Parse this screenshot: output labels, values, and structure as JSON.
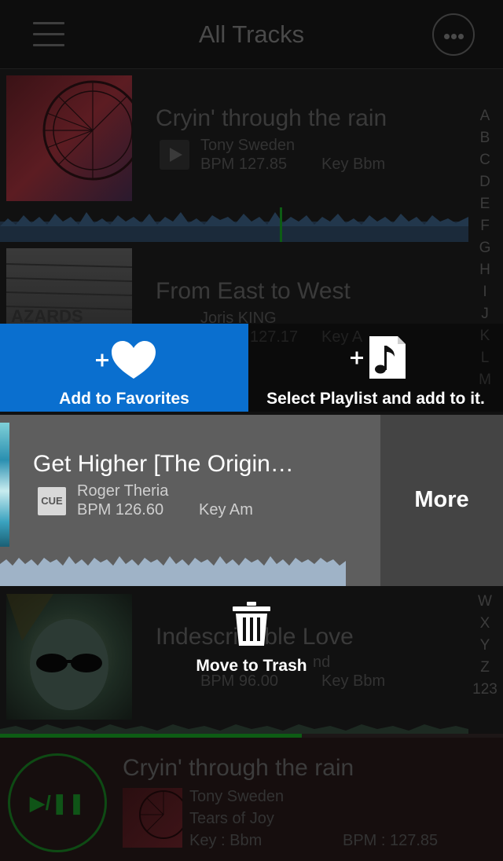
{
  "header": {
    "title": "All Tracks"
  },
  "tracks": [
    {
      "title": "Cryin' through the rain",
      "artist": "Tony Sweden",
      "bpm": "BPM 127.85",
      "key": "Key Bbm"
    },
    {
      "title": "From East to West",
      "artist": "Joris KING",
      "bpm": "127.17",
      "key": "Key A"
    },
    {
      "title": "Indescribable Love",
      "artist": "nd",
      "bpm": "BPM 96.00",
      "key": "Key Bbm"
    }
  ],
  "active_track": {
    "title": "Get Higher [The Origin…",
    "cue_label": "CUE",
    "artist": "Roger Theria",
    "bpm": "BPM 126.60",
    "key": "Key Am"
  },
  "actions": {
    "favorites_label": "Add to Favorites",
    "playlist_label": "Select Playlist and add to it.",
    "more_label": "More",
    "trash_label": "Move to Trash",
    "plus_symbol": "+"
  },
  "alphabet_top": [
    "A",
    "B",
    "C",
    "D",
    "E",
    "F",
    "G",
    "H",
    "I",
    "J",
    "K",
    "L",
    "M"
  ],
  "alphabet_bottom": [
    "W",
    "X",
    "Y",
    "Z",
    "123"
  ],
  "now_playing": {
    "title": "Cryin' through the rain",
    "artist": "Tony Sweden",
    "album": "Tears of Joy",
    "key": "Key : Bbm",
    "bpm": "BPM : 127.85",
    "play_pause_symbol": "▶/❚❚",
    "progress": 0.6
  },
  "colors": {
    "favorites_bg": "#0a6fcf",
    "active_row_bg": "#5e5e5e",
    "more_bg": "#444444",
    "progress": "#0d5c14"
  }
}
